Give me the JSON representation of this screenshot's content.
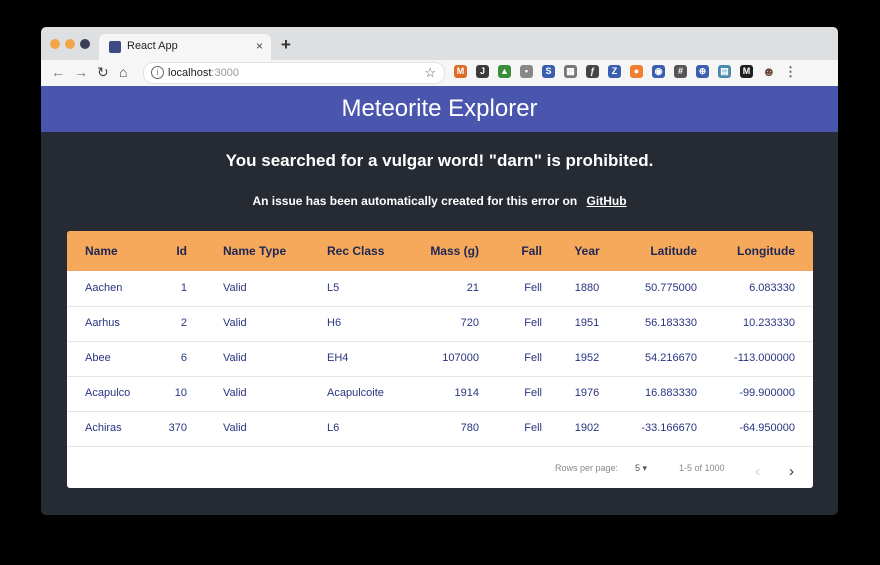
{
  "browser": {
    "tab_title": "React App",
    "tab_close": "×",
    "new_tab": "+",
    "url_host": "localhost",
    "url_port": ":3000",
    "nav": {
      "back": "←",
      "forward": "→",
      "reload": "↻",
      "home": "⌂"
    },
    "bookmark_icon": "star-icon",
    "extensions": [
      {
        "name": "gmail-extension-icon",
        "glyph": "M",
        "color": "#e06a2a"
      },
      {
        "name": "bookmark-extension-icon",
        "glyph": "J",
        "color": "#3b3b3b"
      },
      {
        "name": "drive-extension-icon",
        "glyph": "▲",
        "color": "#3a8e3a"
      },
      {
        "name": "calendar-extension-icon",
        "glyph": "▪",
        "color": "#888888"
      },
      {
        "name": "doc-extension-icon",
        "glyph": "S",
        "color": "#3a5fb0"
      },
      {
        "name": "grid-extension-icon",
        "glyph": "▦",
        "color": "#777777"
      },
      {
        "name": "function-extension-icon",
        "glyph": "ƒ",
        "color": "#444444"
      },
      {
        "name": "zotero-extension-icon",
        "glyph": "Z",
        "color": "#3a5fb0"
      },
      {
        "name": "orange-extension-icon",
        "glyph": "●",
        "color": "#f08030"
      },
      {
        "name": "chat-extension-icon",
        "glyph": "◉",
        "color": "#3a5fb0"
      },
      {
        "name": "hash-extension-icon",
        "glyph": "#",
        "color": "#555555"
      },
      {
        "name": "web-extension-icon",
        "glyph": "⊕",
        "color": "#3a5fb0"
      },
      {
        "name": "screen-extension-icon",
        "glyph": "▤",
        "color": "#4a8ab0"
      },
      {
        "name": "mdn-extension-icon",
        "glyph": "M",
        "color": "#1d1d1d"
      },
      {
        "name": "profile-avatar-icon",
        "glyph": "☻",
        "color": "#6a4a3a"
      },
      {
        "name": "menu-kebab-icon",
        "glyph": "⋮",
        "color": "#666666"
      }
    ]
  },
  "app": {
    "title": "Meteorite Explorer",
    "error_title": "You searched for a vulgar word! \"darn\" is prohibited.",
    "error_sub": "An issue has been automatically created for this error on",
    "error_link": "GitHub"
  },
  "table": {
    "columns": [
      "Name",
      "Id",
      "Name Type",
      "Rec Class",
      "Mass (g)",
      "Fall",
      "Year",
      "Latitude",
      "Longitude"
    ],
    "rows": [
      [
        "Aachen",
        "1",
        "Valid",
        "L5",
        "21",
        "Fell",
        "1880",
        "50.775000",
        "6.083330"
      ],
      [
        "Aarhus",
        "2",
        "Valid",
        "H6",
        "720",
        "Fell",
        "1951",
        "56.183330",
        "10.233330"
      ],
      [
        "Abee",
        "6",
        "Valid",
        "EH4",
        "107000",
        "Fell",
        "1952",
        "54.216670",
        "-113.000000"
      ],
      [
        "Acapulco",
        "10",
        "Valid",
        "Acapulcoite",
        "1914",
        "Fell",
        "1976",
        "16.883330",
        "-99.900000"
      ],
      [
        "Achiras",
        "370",
        "Valid",
        "L6",
        "780",
        "Fell",
        "1902",
        "-33.166670",
        "-64.950000"
      ]
    ],
    "footer": {
      "rows_per_page_label": "Rows per page:",
      "rows_per_page_value": "5 ▾",
      "range": "1-5 of 1000",
      "prev": "‹",
      "next": "›"
    }
  }
}
